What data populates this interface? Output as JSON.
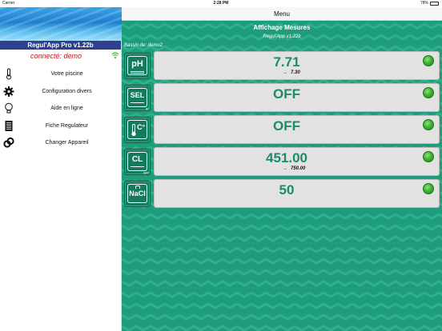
{
  "status_bar": {
    "carrier": "Carrier",
    "time": "2:28 PM",
    "battery": "78%",
    "battery_fraction": 0.78
  },
  "sidebar": {
    "app_title": "Regul'App Pro v1.22b",
    "connection_status": "connecté: demo",
    "items": [
      {
        "label": "Votre piscine",
        "icon": "thermometer-icon"
      },
      {
        "label": "Configuration divers",
        "icon": "gear-icon"
      },
      {
        "label": "Aide en ligne",
        "icon": "lightbulb-icon"
      },
      {
        "label": "Fiche Regulateur",
        "icon": "document-icon"
      },
      {
        "label": "Changer Appareil",
        "icon": "link-icon"
      }
    ]
  },
  "main": {
    "nav_title": "Menu",
    "header_title": "Affichage Mesures",
    "header_subtitle": "Regul'App v1.22b",
    "bassin_label": "Bassin de: demo2",
    "measures": [
      {
        "button": "pH",
        "sub": "",
        "value": "7.71",
        "target_arrow": "→",
        "target": "7.30",
        "status_color": "#3fb534"
      },
      {
        "button": "SEL",
        "sub": "g/l",
        "value": "OFF",
        "target_arrow": "",
        "target": "",
        "status_color": "#3fb534"
      },
      {
        "button": "C°",
        "sub": "",
        "value": "OFF",
        "target_arrow": "",
        "target": "",
        "status_color": "#3fb534"
      },
      {
        "button": "CL",
        "sub": "ppm",
        "value": "451.00",
        "target_arrow": "→",
        "target": "750.00",
        "status_color": "#3fb534"
      },
      {
        "button": "NaCl",
        "sub": "",
        "value": "50",
        "target_arrow": "",
        "target": "",
        "status_color": "#3fb534"
      }
    ]
  },
  "colors": {
    "background_green": "#1f9c7c",
    "value_text": "#1d8a6c",
    "status_led": "#3fb534",
    "sidebar_title_bar": "#2f3f8f",
    "connection_text": "#c0141c"
  }
}
